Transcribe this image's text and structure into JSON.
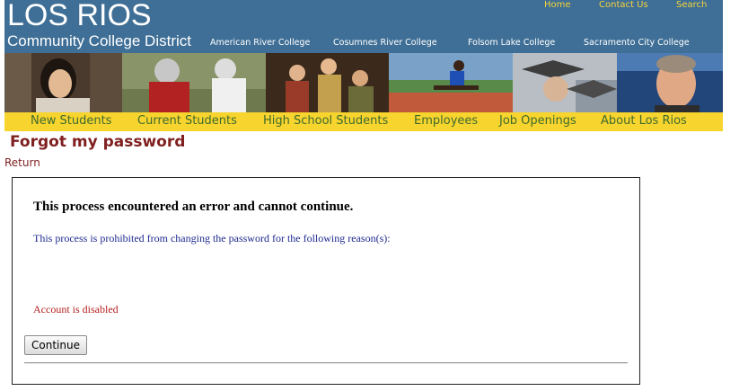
{
  "header": {
    "logo_main": "LOS RIOS",
    "logo_sub": "Community College District",
    "top_links": [
      "Home",
      "Contact Us",
      "Search"
    ],
    "colleges": [
      "American River College",
      "Cosumnes River College",
      "Folsom Lake College",
      "Sacramento City College"
    ]
  },
  "nav": {
    "items": [
      "New Students",
      "Current Students",
      "High School Students",
      "Employees",
      "Job Openings",
      "About Los Rios"
    ]
  },
  "page": {
    "title": "Forgot my password",
    "return_label": "Return"
  },
  "error": {
    "heading": "This process encountered an error and cannot continue.",
    "intro": "This process is prohibited from changing the password for the following reason(s):",
    "reason": "Account is disabled",
    "continue_label": "Continue"
  },
  "colors": {
    "header_bg": "#3f6f96",
    "top_link": "#f5d33a",
    "nav_bg": "#f7d42e",
    "nav_text": "#3e6a2c",
    "title": "#7f1f1f",
    "intro_text": "#1f2a8f",
    "reason_text": "#b52020"
  }
}
